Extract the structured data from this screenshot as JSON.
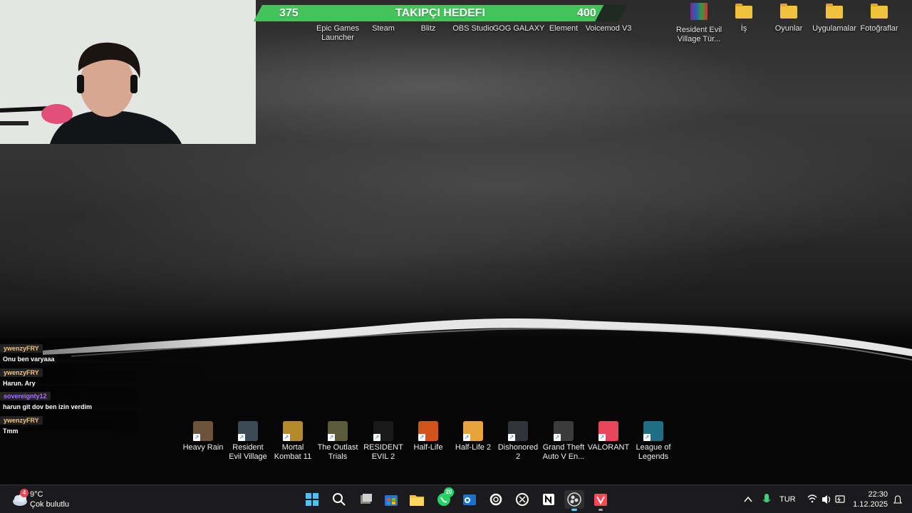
{
  "stream_overlay": {
    "goal_current": "375",
    "goal_title": "TAKIPÇI HEDEFI",
    "goal_target": "400",
    "goal_progress": 0.9375,
    "goal_color": "#44c35a"
  },
  "top_shortcuts": [
    {
      "label": "Epic Games Launcher",
      "icon": "epic-games-icon"
    },
    {
      "label": "Steam",
      "icon": "steam-icon"
    },
    {
      "label": "Blitz",
      "icon": "blitz-icon"
    },
    {
      "label": "OBS Studio",
      "icon": "obs-icon"
    },
    {
      "label": "GOG GALAXY",
      "icon": "gog-icon"
    },
    {
      "label": "Element",
      "icon": "element-icon"
    },
    {
      "label": "Voicemod V3",
      "icon": "voicemod-icon"
    }
  ],
  "right_icons": [
    {
      "label": "Resident Evil Village Tür...",
      "icon": "winrar-archive-icon"
    },
    {
      "label": "İş",
      "icon": "folder-icon"
    },
    {
      "label": "Oyunlar",
      "icon": "folder-icon"
    },
    {
      "label": "Uygulamalar",
      "icon": "folder-icon"
    },
    {
      "label": "Fotoğraflar",
      "icon": "folder-icon"
    }
  ],
  "chat": [
    {
      "user": "ywenzyFRY",
      "color": "#f2c27a",
      "message": "Onu ben varyaaa"
    },
    {
      "user": "ywenzyFRY",
      "color": "#f2c27a",
      "message": "Harun. Ary"
    },
    {
      "user": "sovereignty12",
      "color": "#a970ff",
      "message": "harun git dov ben izin verdim"
    },
    {
      "user": "ywenzyFRY",
      "color": "#f2c27a",
      "message": "Tmm"
    }
  ],
  "game_shortcuts": [
    {
      "label": "Heavy Rain",
      "icon": "heavy-rain-icon",
      "color": "#6b5238"
    },
    {
      "label": "Resident Evil Village",
      "icon": "re-village-icon",
      "color": "#3c4a55"
    },
    {
      "label": "Mortal Kombat 11",
      "icon": "mk11-icon",
      "color": "#b58a2a"
    },
    {
      "label": "The Outlast Trials",
      "icon": "outlast-icon",
      "color": "#5d5a3c"
    },
    {
      "label": "RESIDENT EVIL 2",
      "icon": "re2-icon",
      "color": "#1a1a1a"
    },
    {
      "label": "Half-Life",
      "icon": "half-life-icon",
      "color": "#d3521c"
    },
    {
      "label": "Half-Life 2",
      "icon": "half-life-2-icon",
      "color": "#e8a33b"
    },
    {
      "label": "Dishonored 2",
      "icon": "dishonored-icon",
      "color": "#30343a"
    },
    {
      "label": "Grand Theft Auto V En...",
      "icon": "gta-v-icon",
      "color": "#3b3b3b"
    },
    {
      "label": "VALORANT",
      "icon": "valorant-icon",
      "color": "#e8455a"
    },
    {
      "label": "League of Legends",
      "icon": "lol-icon",
      "color": "#1d6f86"
    }
  ],
  "taskbar": {
    "weather_badge": "4",
    "weather_temp": "9°C",
    "weather_desc": "Çok bulutlu",
    "whatsapp_badge": "20",
    "language": "TUR",
    "time": "22:30",
    "date": "1.12.2025"
  }
}
